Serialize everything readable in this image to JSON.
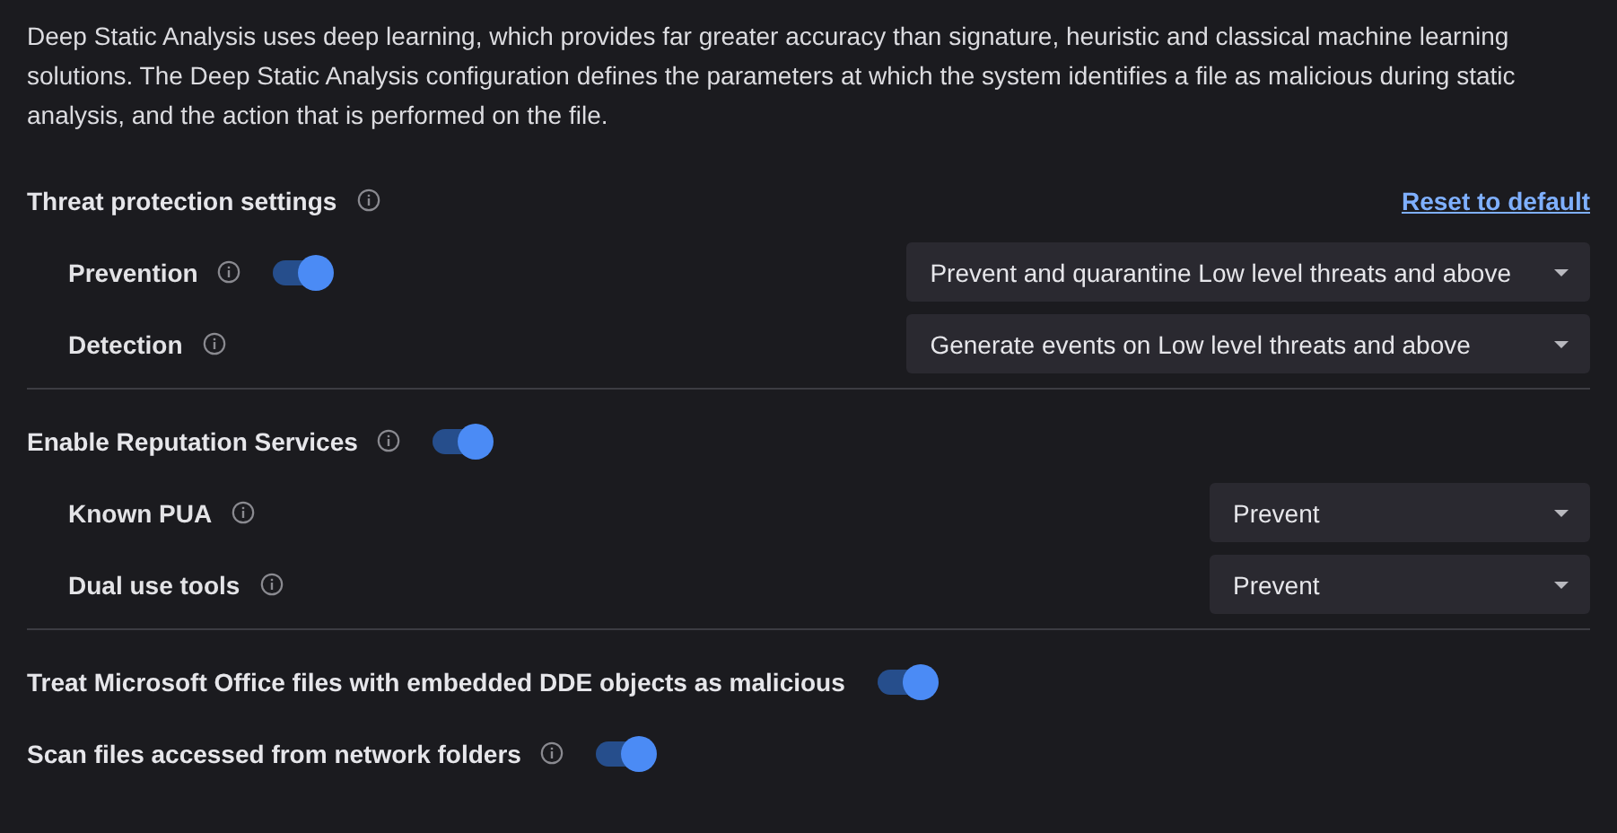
{
  "description": "Deep Static Analysis uses deep learning, which provides far greater accuracy than signature, heuristic and classical machine learning solutions. The Deep Static Analysis configuration defines the parameters at which the system identifies a file as malicious during static analysis, and the action that is performed on the file.",
  "groups": [
    {
      "settings": [
        {
          "title": "Threat protection settings",
          "info": true,
          "link": "Reset to default",
          "rows": [
            {
              "label": "Prevention",
              "info": true,
              "on": true,
              "select": "Prevent and quarantine Low level threats and above"
            },
            {
              "label": "Detection",
              "info": true,
              "select": "Generate events on Low level threats and above"
            }
          ]
        }
      ]
    },
    {
      "settings": [
        {
          "title": "Enable Reputation Services",
          "info": true,
          "on": true,
          "rows": [
            {
              "label": "Known PUA",
              "info": true,
              "select": "Prevent"
            },
            {
              "label": "Dual use tools",
              "info": true,
              "select": "Prevent"
            }
          ]
        }
      ]
    },
    {
      "settings": [
        {
          "title": "Treat Microsoft Office files with embedded DDE objects as malicious",
          "info": false,
          "on": true
        },
        {
          "title": "Scan files accessed from network folders",
          "info": true,
          "on": true
        }
      ]
    }
  ]
}
